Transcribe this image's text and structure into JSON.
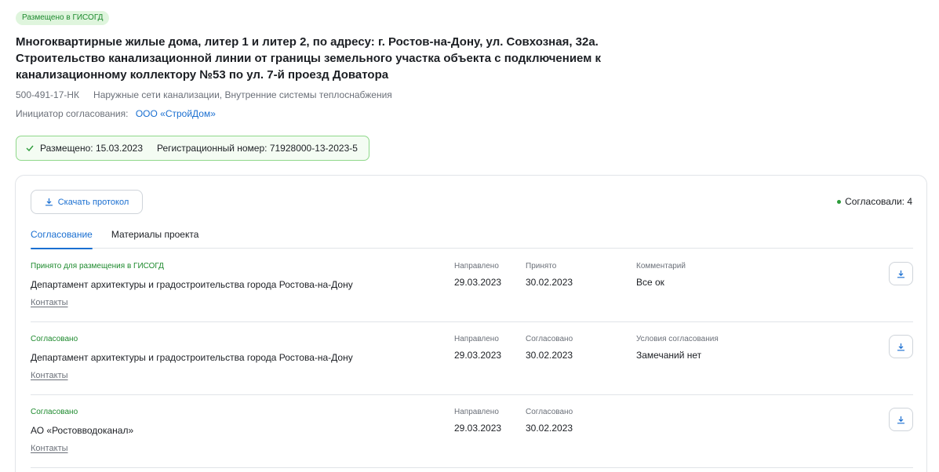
{
  "badge_top": "Размещено в ГИСОГД",
  "title": "Многоквартирные жилые дома, литер 1 и литер 2, по адресу: г. Ростов-на-Дону, ул. Совхозная, 32а. Строительство канализационной линии от границы земельного участка объекта с подключением к канализационному коллектору №53 по ул. 7-й проезд Доватора",
  "code": "500-491-17-НК",
  "systems": "Наружные сети канализации, Внутренние системы теплоснабжения",
  "initiator_label": "Инициатор согласования:",
  "initiator_name": "ООО «СтройДом»",
  "placed": {
    "text": "Размещено: 15.03.2023",
    "reg": "Регистрационный номер: 71928000-13-2023-5"
  },
  "card": {
    "download_protocol": "Скачать протокол",
    "agreed_count": "Согласовали: 4",
    "tabs": [
      {
        "label": "Согласование",
        "active": true
      },
      {
        "label": "Материалы проекта",
        "active": false
      }
    ],
    "rows": [
      {
        "status": "Принято для размещения в ГИСОГД",
        "org": "Департамент архитектуры и градостроительства города Ростова-на-Дону",
        "contacts": "Контакты",
        "col1_label": "Направлено",
        "col1_value": "29.03.2023",
        "col2_label": "Принято",
        "col2_value": "30.02.2023",
        "col3_label": "Комментарий",
        "col3_value": "Все ок"
      },
      {
        "status": "Согласовано",
        "org": "Департамент архитектуры и градостроительства города Ростова-на-Дону",
        "contacts": "Контакты",
        "col1_label": "Направлено",
        "col1_value": "29.03.2023",
        "col2_label": "Согласовано",
        "col2_value": "30.02.2023",
        "col3_label": "Условия согласования",
        "col3_value": "Замечаний нет"
      },
      {
        "status": "Согласовано",
        "org": "АО «Ростовводоканал»",
        "contacts": "Контакты",
        "col1_label": "Направлено",
        "col1_value": "29.03.2023",
        "col2_label": "Согласовано",
        "col2_value": "30.02.2023",
        "col3_label": "",
        "col3_value": ""
      }
    ]
  },
  "colors": {
    "accent": "#1a6fd1",
    "success": "#1e8a2e",
    "success_bg": "#dff5dd",
    "border": "#e1e4e8"
  },
  "icons": {
    "check": "check-icon",
    "download": "download-icon"
  }
}
